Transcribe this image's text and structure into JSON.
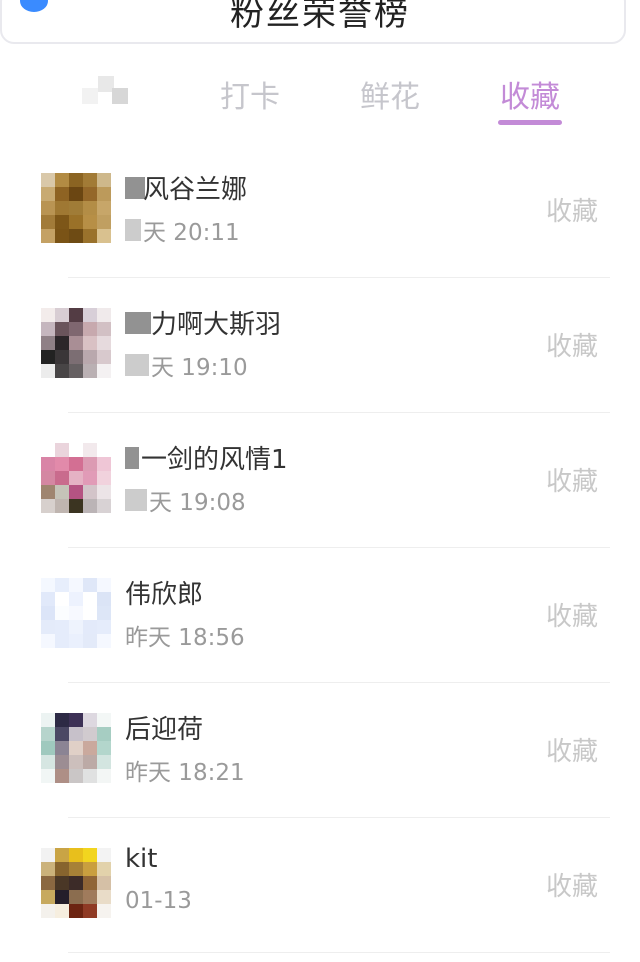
{
  "header": {
    "title": "粉丝荣誉榜"
  },
  "tabs": [
    {
      "label": "打卡",
      "selected": false
    },
    {
      "label": "鲜花",
      "selected": false
    },
    {
      "label": "收藏",
      "selected": true
    }
  ],
  "accent_color": "#c38bd7",
  "rows": [
    {
      "name": "风谷兰娜",
      "time": "天 20:11",
      "action": "收藏"
    },
    {
      "name": "力啊大斯羽",
      "time": "天 19:10",
      "action": "收藏"
    },
    {
      "name": "一剑的风情1",
      "time": "天 19:08",
      "action": "收藏"
    },
    {
      "name": "伟欣郎",
      "time": "昨天 18:56",
      "action": "收藏"
    },
    {
      "name": "后迎荷",
      "time": "昨天 18:21",
      "action": "收藏"
    },
    {
      "name": "kit",
      "time": "01-13",
      "action": "收藏"
    }
  ]
}
